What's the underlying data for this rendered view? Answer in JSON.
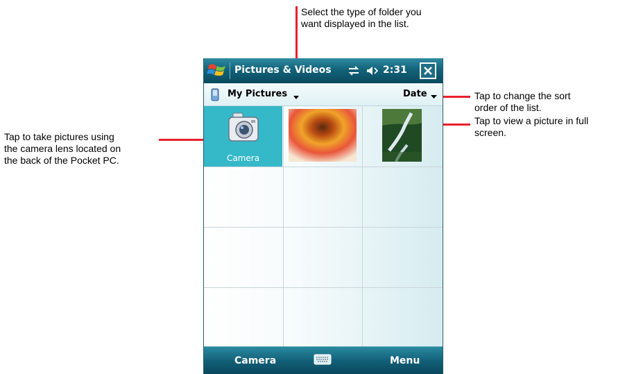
{
  "callouts": {
    "folder_type": "Select the type of folder you\nwant displayed in the list.",
    "sort_order": "Tap to change the sort\norder of the list.",
    "view_picture": "Tap to view a picture in full\nscreen.",
    "take_pictures": "Tap to take pictures using\nthe camera lens located on\nthe back of the Pocket PC."
  },
  "titlebar": {
    "title": "Pictures & Videos",
    "time": "2:31",
    "icons": [
      "windows-start-icon",
      "sync-icon",
      "volume-icon",
      "close-icon"
    ]
  },
  "folderbar": {
    "folder": "My Pictures",
    "sort": "Date",
    "icons": [
      "device-icon",
      "dropdown-arrow-icon"
    ]
  },
  "grid": {
    "items": [
      {
        "label": "Camera",
        "icon": "camera-icon"
      },
      {
        "label": "",
        "icon": "flower-thumbnail"
      },
      {
        "label": "",
        "icon": "waterfall-thumbnail"
      }
    ]
  },
  "softkeys": {
    "left": "Camera",
    "right": "Menu",
    "center_icon": "keyboard-icon"
  },
  "colors": {
    "callout_line": "#e8202a",
    "titlebar": "#13637a",
    "selected_cell": "#35b8c8"
  }
}
